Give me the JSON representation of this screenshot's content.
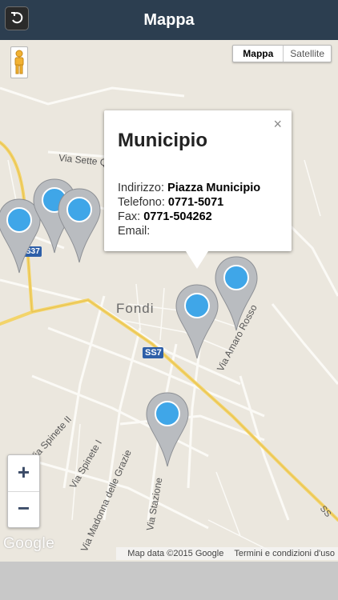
{
  "header": {
    "title": "Mappa",
    "back_icon": "back-arrow-icon",
    "background": "#2c3e50"
  },
  "map_type": {
    "options": [
      "Mappa",
      "Satellite"
    ],
    "selected": "Mappa"
  },
  "info_window": {
    "title": "Municipio",
    "close_label": "×",
    "address_label": "Indirizzo: ",
    "address_value": "Piazza Municipio",
    "phone_label": "Telefono: ",
    "phone_value": "0771-5071",
    "fax_label": "Fax: ",
    "fax_value": "0771-504262",
    "email_label": "Email:",
    "email_value": ""
  },
  "map_labels": {
    "town": "Fondi",
    "route_ss7": "SS7",
    "route_s37": "S37",
    "street_sette": "Via Sette Q",
    "street_spinete2": "Via Spinete II",
    "street_spinete1": "Via Spinete I",
    "street_madonna": "Via Madonna delle Grazie",
    "street_stazione": "Via Stazione",
    "street_amaro": "Via Amaro Rosso",
    "route_edge": "SS"
  },
  "zoom": {
    "in_label": "+",
    "out_label": "−"
  },
  "attribution": {
    "google": "Google",
    "map_data": "Map data ©2015 Google",
    "terms": "Termini e condizioni d'uso"
  }
}
